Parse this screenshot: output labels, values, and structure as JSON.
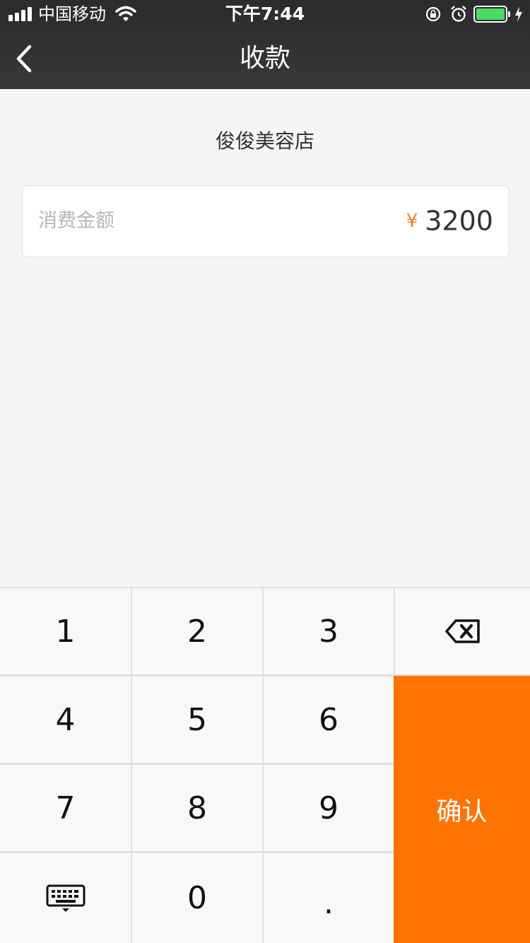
{
  "status_bar": {
    "carrier": "中国移动",
    "time": "下午7:44",
    "battery_color": "#4cd964"
  },
  "nav": {
    "title": "收款",
    "back_icon": "chevron-left-icon"
  },
  "shop": {
    "name": "俊俊美容店"
  },
  "amount": {
    "label": "消费金额",
    "currency_symbol": "¥",
    "value": "3200",
    "currency_color": "#f07a24"
  },
  "keypad": {
    "keys": {
      "k1": "1",
      "k2": "2",
      "k3": "3",
      "k4": "4",
      "k5": "5",
      "k6": "6",
      "k7": "7",
      "k8": "8",
      "k9": "9",
      "k0": "0",
      "dot": "."
    },
    "backspace_icon": "backspace-icon",
    "hide_keyboard_icon": "keyboard-hide-icon",
    "confirm_label": "确认",
    "confirm_color": "#ff7302"
  }
}
